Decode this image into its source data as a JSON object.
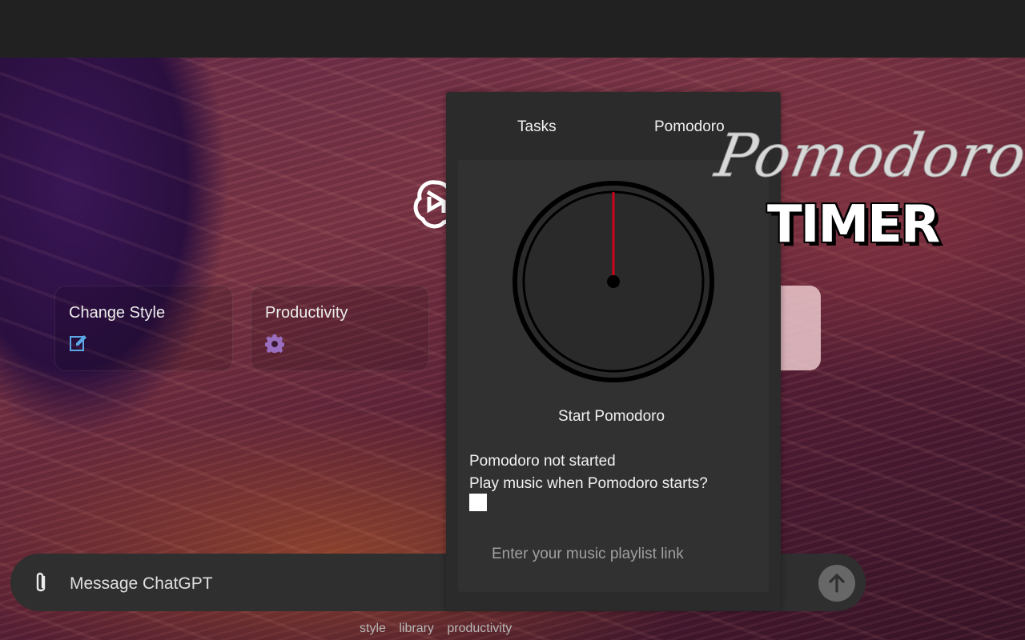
{
  "cards": [
    {
      "title": "Change Style",
      "icon": "edit-icon"
    },
    {
      "title": "Productivity",
      "icon": "gear-icon"
    }
  ],
  "composer": {
    "placeholder": "Message ChatGPT",
    "attach_icon": "paperclip-icon",
    "send_icon": "arrow-up-icon"
  },
  "footer": {
    "links": [
      "style",
      "library",
      "productivity"
    ]
  },
  "panel": {
    "tabs": [
      "Tasks",
      "Pomodoro"
    ],
    "start_label": "Start Pomodoro",
    "status": "Pomodoro not started",
    "music_question": "Play music when Pomodoro starts?",
    "playlist_placeholder": "Enter your music playlist link",
    "hand_color": "#d0021b"
  },
  "brand": {
    "script": "Pomodoro",
    "block": "TIMER"
  },
  "colors": {
    "accent_purple": "#9b6fbf",
    "edit_blue": "#5aa9e6"
  }
}
